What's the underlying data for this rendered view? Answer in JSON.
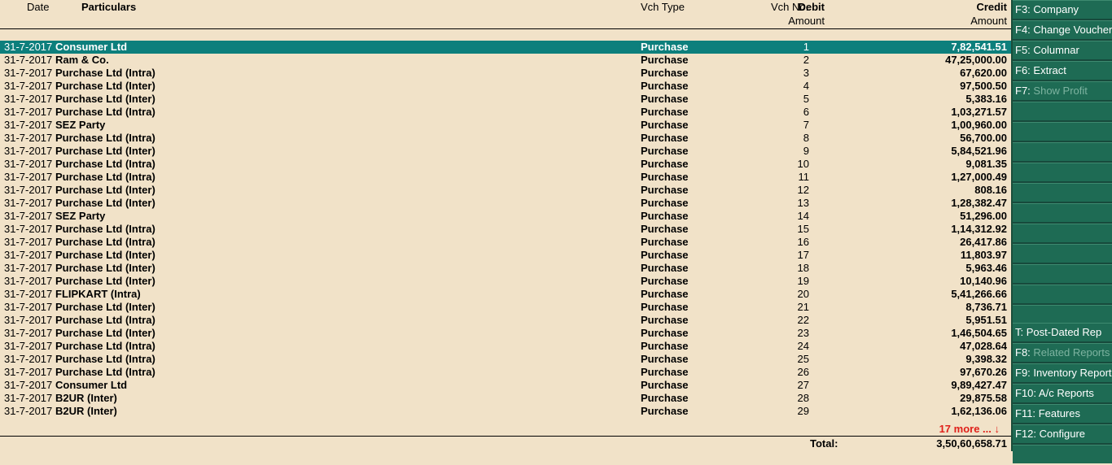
{
  "header": {
    "date": "Date",
    "particulars": "Particulars",
    "vch_type": "Vch Type",
    "vch_no": "Vch No.",
    "debit": "Debit",
    "debit_sub": "Amount",
    "credit": "Credit",
    "credit_sub": "Amount"
  },
  "rows": [
    {
      "date": "31-7-2017",
      "particulars": "Consumer Ltd",
      "vch_type": "Purchase",
      "vch_no": "1",
      "amount": "7,82,541.51"
    },
    {
      "date": "31-7-2017",
      "particulars": "Ram & Co.",
      "vch_type": "Purchase",
      "vch_no": "2",
      "amount": "47,25,000.00"
    },
    {
      "date": "31-7-2017",
      "particulars": "Purchase Ltd (Intra)",
      "vch_type": "Purchase",
      "vch_no": "3",
      "amount": "67,620.00"
    },
    {
      "date": "31-7-2017",
      "particulars": "Purchase Ltd (Inter)",
      "vch_type": "Purchase",
      "vch_no": "4",
      "amount": "97,500.50"
    },
    {
      "date": "31-7-2017",
      "particulars": "Purchase Ltd (Inter)",
      "vch_type": "Purchase",
      "vch_no": "5",
      "amount": "5,383.16"
    },
    {
      "date": "31-7-2017",
      "particulars": "Purchase Ltd (Intra)",
      "vch_type": "Purchase",
      "vch_no": "6",
      "amount": "1,03,271.57"
    },
    {
      "date": "31-7-2017",
      "particulars": "SEZ Party",
      "vch_type": "Purchase",
      "vch_no": "7",
      "amount": "1,00,960.00"
    },
    {
      "date": "31-7-2017",
      "particulars": "Purchase Ltd (Intra)",
      "vch_type": "Purchase",
      "vch_no": "8",
      "amount": "56,700.00"
    },
    {
      "date": "31-7-2017",
      "particulars": "Purchase Ltd (Inter)",
      "vch_type": "Purchase",
      "vch_no": "9",
      "amount": "5,84,521.96"
    },
    {
      "date": "31-7-2017",
      "particulars": "Purchase Ltd (Intra)",
      "vch_type": "Purchase",
      "vch_no": "10",
      "amount": "9,081.35"
    },
    {
      "date": "31-7-2017",
      "particulars": "Purchase Ltd (Intra)",
      "vch_type": "Purchase",
      "vch_no": "11",
      "amount": "1,27,000.49"
    },
    {
      "date": "31-7-2017",
      "particulars": "Purchase Ltd (Inter)",
      "vch_type": "Purchase",
      "vch_no": "12",
      "amount": "808.16"
    },
    {
      "date": "31-7-2017",
      "particulars": "Purchase Ltd (Inter)",
      "vch_type": "Purchase",
      "vch_no": "13",
      "amount": "1,28,382.47"
    },
    {
      "date": "31-7-2017",
      "particulars": "SEZ Party",
      "vch_type": "Purchase",
      "vch_no": "14",
      "amount": "51,296.00"
    },
    {
      "date": "31-7-2017",
      "particulars": "Purchase Ltd (Intra)",
      "vch_type": "Purchase",
      "vch_no": "15",
      "amount": "1,14,312.92"
    },
    {
      "date": "31-7-2017",
      "particulars": "Purchase Ltd (Intra)",
      "vch_type": "Purchase",
      "vch_no": "16",
      "amount": "26,417.86"
    },
    {
      "date": "31-7-2017",
      "particulars": "Purchase Ltd (Inter)",
      "vch_type": "Purchase",
      "vch_no": "17",
      "amount": "11,803.97"
    },
    {
      "date": "31-7-2017",
      "particulars": "Purchase Ltd (Inter)",
      "vch_type": "Purchase",
      "vch_no": "18",
      "amount": "5,963.46"
    },
    {
      "date": "31-7-2017",
      "particulars": "Purchase Ltd (Inter)",
      "vch_type": "Purchase",
      "vch_no": "19",
      "amount": "10,140.96"
    },
    {
      "date": "31-7-2017",
      "particulars": "FLIPKART (Intra)",
      "vch_type": "Purchase",
      "vch_no": "20",
      "amount": "5,41,266.66"
    },
    {
      "date": "31-7-2017",
      "particulars": "Purchase Ltd (Inter)",
      "vch_type": "Purchase",
      "vch_no": "21",
      "amount": "8,736.71"
    },
    {
      "date": "31-7-2017",
      "particulars": "Purchase Ltd (Intra)",
      "vch_type": "Purchase",
      "vch_no": "22",
      "amount": "5,951.51"
    },
    {
      "date": "31-7-2017",
      "particulars": "Purchase Ltd (Inter)",
      "vch_type": "Purchase",
      "vch_no": "23",
      "amount": "1,46,504.65"
    },
    {
      "date": "31-7-2017",
      "particulars": "Purchase Ltd (Intra)",
      "vch_type": "Purchase",
      "vch_no": "24",
      "amount": "47,028.64"
    },
    {
      "date": "31-7-2017",
      "particulars": "Purchase Ltd (Intra)",
      "vch_type": "Purchase",
      "vch_no": "25",
      "amount": "9,398.32"
    },
    {
      "date": "31-7-2017",
      "particulars": "Purchase Ltd (Intra)",
      "vch_type": "Purchase",
      "vch_no": "26",
      "amount": "97,670.26"
    },
    {
      "date": "31-7-2017",
      "particulars": "Consumer Ltd",
      "vch_type": "Purchase",
      "vch_no": "27",
      "amount": "9,89,427.47"
    },
    {
      "date": "31-7-2017",
      "particulars": "B2UR (Inter)",
      "vch_type": "Purchase",
      "vch_no": "28",
      "amount": "29,875.58"
    },
    {
      "date": "31-7-2017",
      "particulars": "B2UR (Inter)",
      "vch_type": "Purchase",
      "vch_no": "29",
      "amount": "1,62,136.06"
    }
  ],
  "more": "17 more ... ↓",
  "total": {
    "label": "Total:",
    "amount": "3,50,60,658.71"
  },
  "sidebar": {
    "top": [
      {
        "key": "F3:",
        "label": "Company",
        "enabled": true
      },
      {
        "key": "F4:",
        "label": "Change Voucher",
        "enabled": true
      },
      {
        "key": "F5:",
        "label": "Columnar",
        "enabled": true
      },
      {
        "key": "F6:",
        "label": "Extract",
        "enabled": true
      },
      {
        "key": "F7:",
        "label": "Show Profit",
        "enabled": false
      }
    ],
    "bottom": [
      {
        "key": "T:",
        "label": "Post-Dated Rep",
        "enabled": true
      },
      {
        "key": "F8:",
        "label": "Related Reports",
        "enabled": false
      },
      {
        "key": "F9:",
        "label": "Inventory Reports",
        "enabled": true
      },
      {
        "key": "F10:",
        "label": "A/c Reports",
        "enabled": true
      },
      {
        "key": "F11:",
        "label": "Features",
        "enabled": true
      },
      {
        "key": "F12:",
        "label": "Configure",
        "enabled": true
      }
    ]
  },
  "colors": {
    "selected_row": "#0d7f7c",
    "background": "#f1e2c8",
    "more_text": "#e0201a",
    "sidebar": "#1e6b54"
  }
}
